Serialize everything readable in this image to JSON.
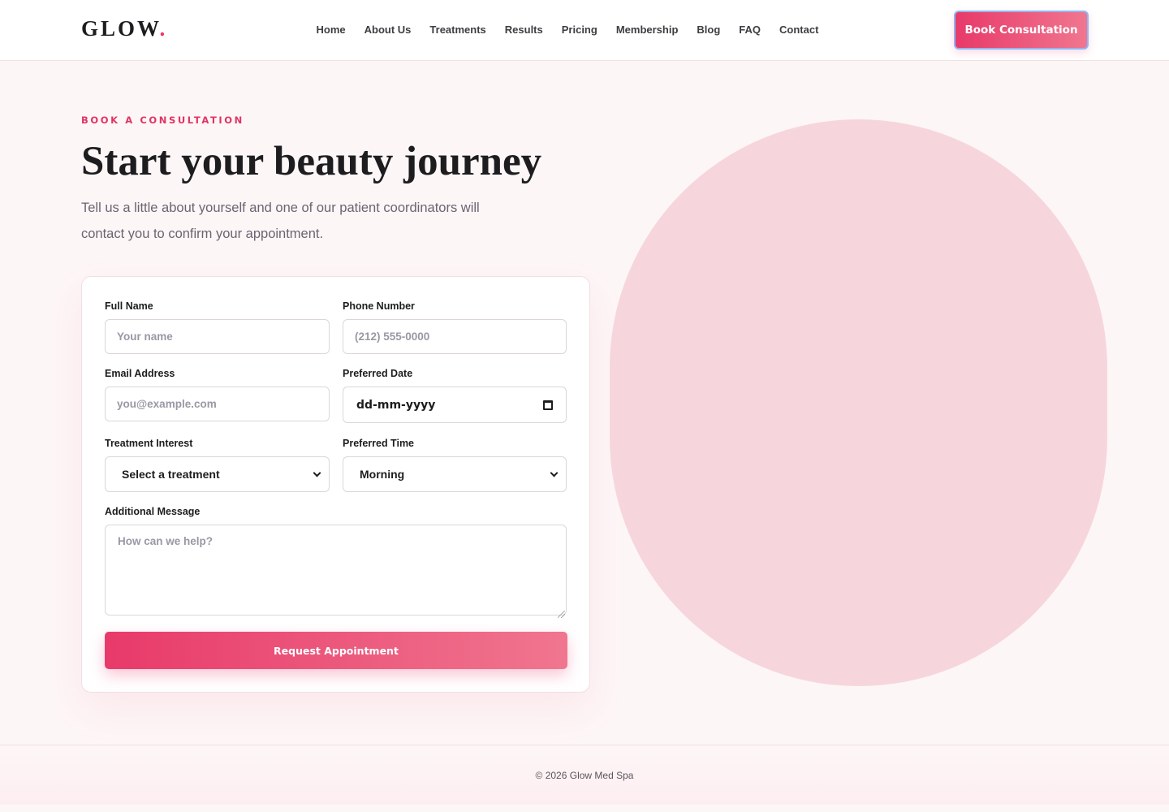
{
  "brand": {
    "name": "GLOW",
    "dot": "."
  },
  "nav": {
    "items": [
      {
        "label": "Home"
      },
      {
        "label": "About Us"
      },
      {
        "label": "Treatments"
      },
      {
        "label": "Results"
      },
      {
        "label": "Pricing"
      },
      {
        "label": "Membership"
      },
      {
        "label": "Blog"
      },
      {
        "label": "FAQ"
      },
      {
        "label": "Contact"
      }
    ],
    "cta_label": "Book Consultation"
  },
  "hero": {
    "eyebrow": "BOOK A CONSULTATION",
    "title": "Start your beauty journey",
    "lead": "Tell us a little about yourself and one of our patient coordinators will contact you to confirm your appointment."
  },
  "form": {
    "full_name": {
      "label": "Full Name",
      "placeholder": "Your name",
      "value": ""
    },
    "phone": {
      "label": "Phone Number",
      "placeholder": "(212) 555-0000",
      "value": ""
    },
    "email": {
      "label": "Email Address",
      "placeholder": "you@example.com",
      "value": ""
    },
    "date": {
      "label": "Preferred Date",
      "value": "dd-mm-yyyy"
    },
    "treatment": {
      "label": "Treatment Interest",
      "selected": "Select a treatment"
    },
    "time": {
      "label": "Preferred Time",
      "selected": "Morning"
    },
    "message": {
      "label": "Additional Message",
      "placeholder": "How can we help?"
    },
    "submit_label": "Request Appointment"
  },
  "footer": {
    "text": "© 2026 Glow Med Spa"
  },
  "colors": {
    "accent": "#e83a6a",
    "accent_light": "#f0768f",
    "background": "#fdf6f7",
    "blob": "#f6d6dc"
  }
}
